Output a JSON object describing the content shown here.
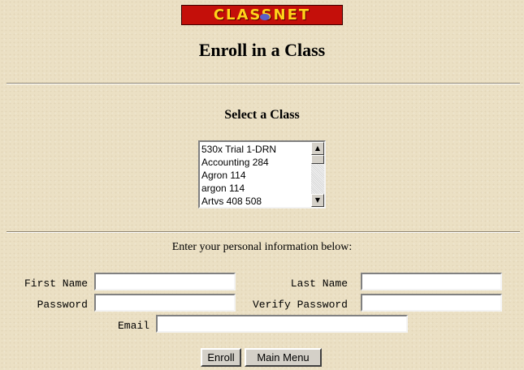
{
  "logo": {
    "text": "CLASSNET"
  },
  "page_title": "Enroll in a Class",
  "class_select": {
    "heading": "Select a Class",
    "options": [
      "530x Trial 1-DRN",
      "Accounting 284",
      "Agron 114",
      "argon 114",
      "Artvs 408 508"
    ]
  },
  "personal_info": {
    "instruction": "Enter your personal information below:",
    "first_name_label": "First Name",
    "last_name_label": "Last Name",
    "password_label": "Password",
    "verify_password_label": "Verify Password",
    "email_label": "Email",
    "first_name_value": "",
    "last_name_value": "",
    "password_value": "",
    "verify_password_value": "",
    "email_value": ""
  },
  "buttons": {
    "enroll": "Enroll",
    "main_menu": "Main Menu"
  },
  "colors": {
    "background": "#ebe0c4",
    "logo_bg": "#c40f0a",
    "logo_text": "#ffd21a"
  }
}
